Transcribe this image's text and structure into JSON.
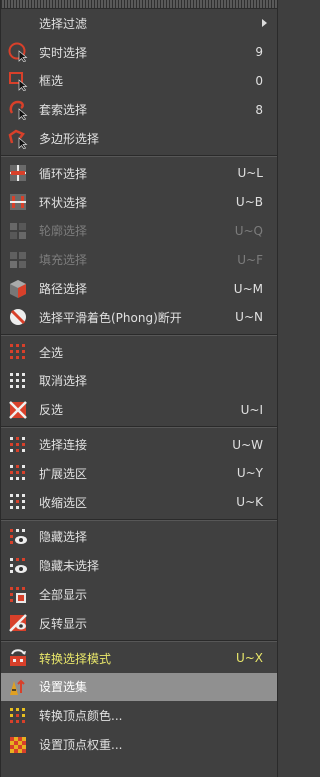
{
  "menu": {
    "items": [
      {
        "label": "选择过滤",
        "shortcut": "",
        "icon": "none",
        "submenu": true
      },
      {
        "label": "实时选择",
        "shortcut": "9",
        "icon": "live-selection-icon"
      },
      {
        "label": "框选",
        "shortcut": "0",
        "icon": "rectangle-selection-icon"
      },
      {
        "label": "套索选择",
        "shortcut": "8",
        "icon": "lasso-selection-icon"
      },
      {
        "label": "多边形选择",
        "shortcut": "",
        "icon": "polygon-selection-icon"
      },
      {
        "label": "循环选择",
        "shortcut": "U~L",
        "icon": "loop-selection-icon"
      },
      {
        "label": "环状选择",
        "shortcut": "U~B",
        "icon": "ring-selection-icon"
      },
      {
        "label": "轮廓选择",
        "shortcut": "U~Q",
        "icon": "outline-selection-icon",
        "disabled": true
      },
      {
        "label": "填充选择",
        "shortcut": "U~F",
        "icon": "fill-selection-icon",
        "disabled": true
      },
      {
        "label": "路径选择",
        "shortcut": "U~M",
        "icon": "path-selection-icon"
      },
      {
        "label": "选择平滑着色(Phong)断开",
        "shortcut": "U~N",
        "icon": "phong-break-selection-icon"
      },
      {
        "label": "全选",
        "shortcut": "",
        "icon": "select-all-icon"
      },
      {
        "label": "取消选择",
        "shortcut": "",
        "icon": "deselect-all-icon"
      },
      {
        "label": "反选",
        "shortcut": "U~I",
        "icon": "invert-selection-icon"
      },
      {
        "label": "选择连接",
        "shortcut": "U~W",
        "icon": "select-connected-icon"
      },
      {
        "label": "扩展选区",
        "shortcut": "U~Y",
        "icon": "grow-selection-icon"
      },
      {
        "label": "收缩选区",
        "shortcut": "U~K",
        "icon": "shrink-selection-icon"
      },
      {
        "label": "隐藏选择",
        "shortcut": "",
        "icon": "hide-selected-icon"
      },
      {
        "label": "隐藏未选择",
        "shortcut": "",
        "icon": "hide-unselected-icon"
      },
      {
        "label": "全部显示",
        "shortcut": "",
        "icon": "unhide-all-icon"
      },
      {
        "label": "反转显示",
        "shortcut": "",
        "icon": "invert-visibility-icon"
      },
      {
        "label": "转换选择模式",
        "shortcut": "U~X",
        "icon": "convert-selection-icon",
        "accent": true
      },
      {
        "label": "设置选集",
        "shortcut": "",
        "icon": "set-selection-icon",
        "highlighted": true
      },
      {
        "label": "转换顶点颜色...",
        "shortcut": "",
        "icon": "vertex-color-icon"
      },
      {
        "label": "设置顶点权重...",
        "shortcut": "",
        "icon": "vertex-weight-icon"
      }
    ]
  }
}
